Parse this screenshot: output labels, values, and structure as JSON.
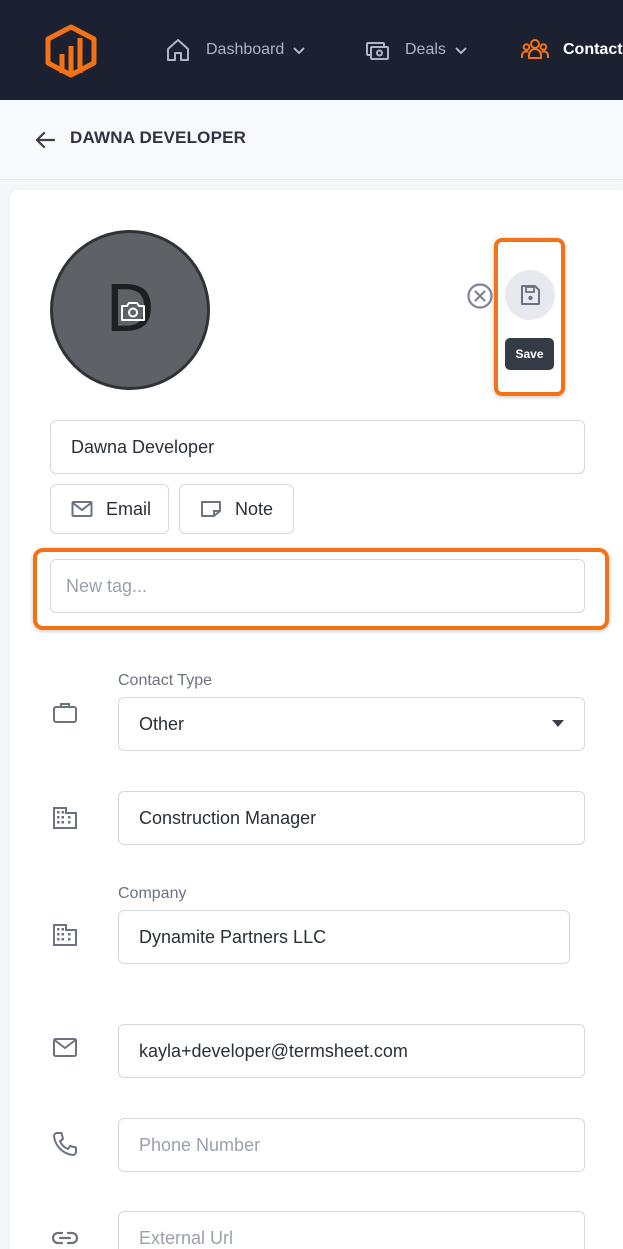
{
  "nav": {
    "items": [
      {
        "label": "Dashboard",
        "icon": "home-icon"
      },
      {
        "label": "Deals",
        "icon": "deals-icon"
      },
      {
        "label": "Contacts",
        "icon": "contacts-icon",
        "active": true
      }
    ],
    "accent_color": "#f47216"
  },
  "header": {
    "title": "DAWNA DEVELOPER"
  },
  "profile": {
    "avatar_initial": "D",
    "save_tooltip": "Save",
    "name_value": "Dawna Developer"
  },
  "actions": {
    "email_label": "Email",
    "note_label": "Note"
  },
  "tags": {
    "placeholder": "New tag..."
  },
  "fields": {
    "contact_type_label": "Contact Type",
    "contact_type_value": "Other",
    "job_title_value": "Construction Manager",
    "company_label": "Company",
    "company_value": "Dynamite Partners LLC",
    "email_value": "kayla+developer@termsheet.com",
    "phone_placeholder": "Phone Number",
    "url_placeholder": "External Url"
  }
}
